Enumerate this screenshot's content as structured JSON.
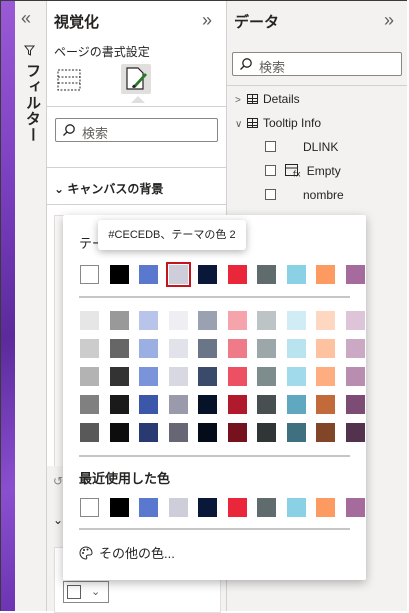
{
  "filter_pane": {
    "label": "フィルター"
  },
  "viz_pane": {
    "title": "視覚化",
    "subtitle": "ページの書式設定",
    "search_placeholder": "検索",
    "section_canvas": "キャンバスの背景"
  },
  "data_pane": {
    "title": "データ",
    "search_placeholder": "検索",
    "tables": [
      {
        "label": "Details",
        "expanded": false
      },
      {
        "label": "Tooltip Info",
        "expanded": true
      }
    ],
    "fields": [
      {
        "label": "DLINK"
      },
      {
        "label": "Empty"
      },
      {
        "label": "nombre"
      }
    ]
  },
  "color_picker": {
    "heading": "テー",
    "tooltip": "#CECEDB、テーマの色 2",
    "theme_colors": [
      "#FFFFFF",
      "#000000",
      "#5B78CF",
      "#CECEDB",
      "#091839",
      "#EA263B",
      "#5F6B6D",
      "#8AD1E5",
      "#FD9A62",
      "#A56B9C"
    ],
    "shade_rows": [
      [
        "#E6E6E6",
        "#999999",
        "#B8C4EA",
        "#EEEEF3",
        "#9AA1B0",
        "#F5A4AC",
        "#BCC4C5",
        "#D0ECF5",
        "#FED7C0",
        "#DDC4D8"
      ],
      [
        "#CCCCCC",
        "#666666",
        "#9CAFE3",
        "#E2E2EA",
        "#6A7587",
        "#F07B88",
        "#9CA7A9",
        "#B9E3EF",
        "#FEC2A0",
        "#CBA9C4"
      ],
      [
        "#B3B3B3",
        "#333333",
        "#7A93D9",
        "#D8D8E2",
        "#3A4A6A",
        "#EC5062",
        "#7F8C8E",
        "#A1DAEA",
        "#FDAD80",
        "#B98DB0"
      ],
      [
        "#808080",
        "#1A1A1A",
        "#3C57A9",
        "#9A9AAD",
        "#061227",
        "#B01A2C",
        "#474F51",
        "#5FA8BF",
        "#C26A3A",
        "#7C4C75"
      ],
      [
        "#595959",
        "#0D0D0D",
        "#283A71",
        "#666675",
        "#040C1A",
        "#75121E",
        "#303536",
        "#3F707F",
        "#814627",
        "#53324E"
      ]
    ],
    "recent_label": "最近使用した色",
    "recent_colors": [
      "#FFFFFF",
      "#000000",
      "#5B78CF",
      "#CECEDB",
      "#091839",
      "#EA263B",
      "#5F6B6D",
      "#8AD1E5",
      "#FD9A62",
      "#A56B9C"
    ],
    "more_colors": "その他の色..."
  }
}
